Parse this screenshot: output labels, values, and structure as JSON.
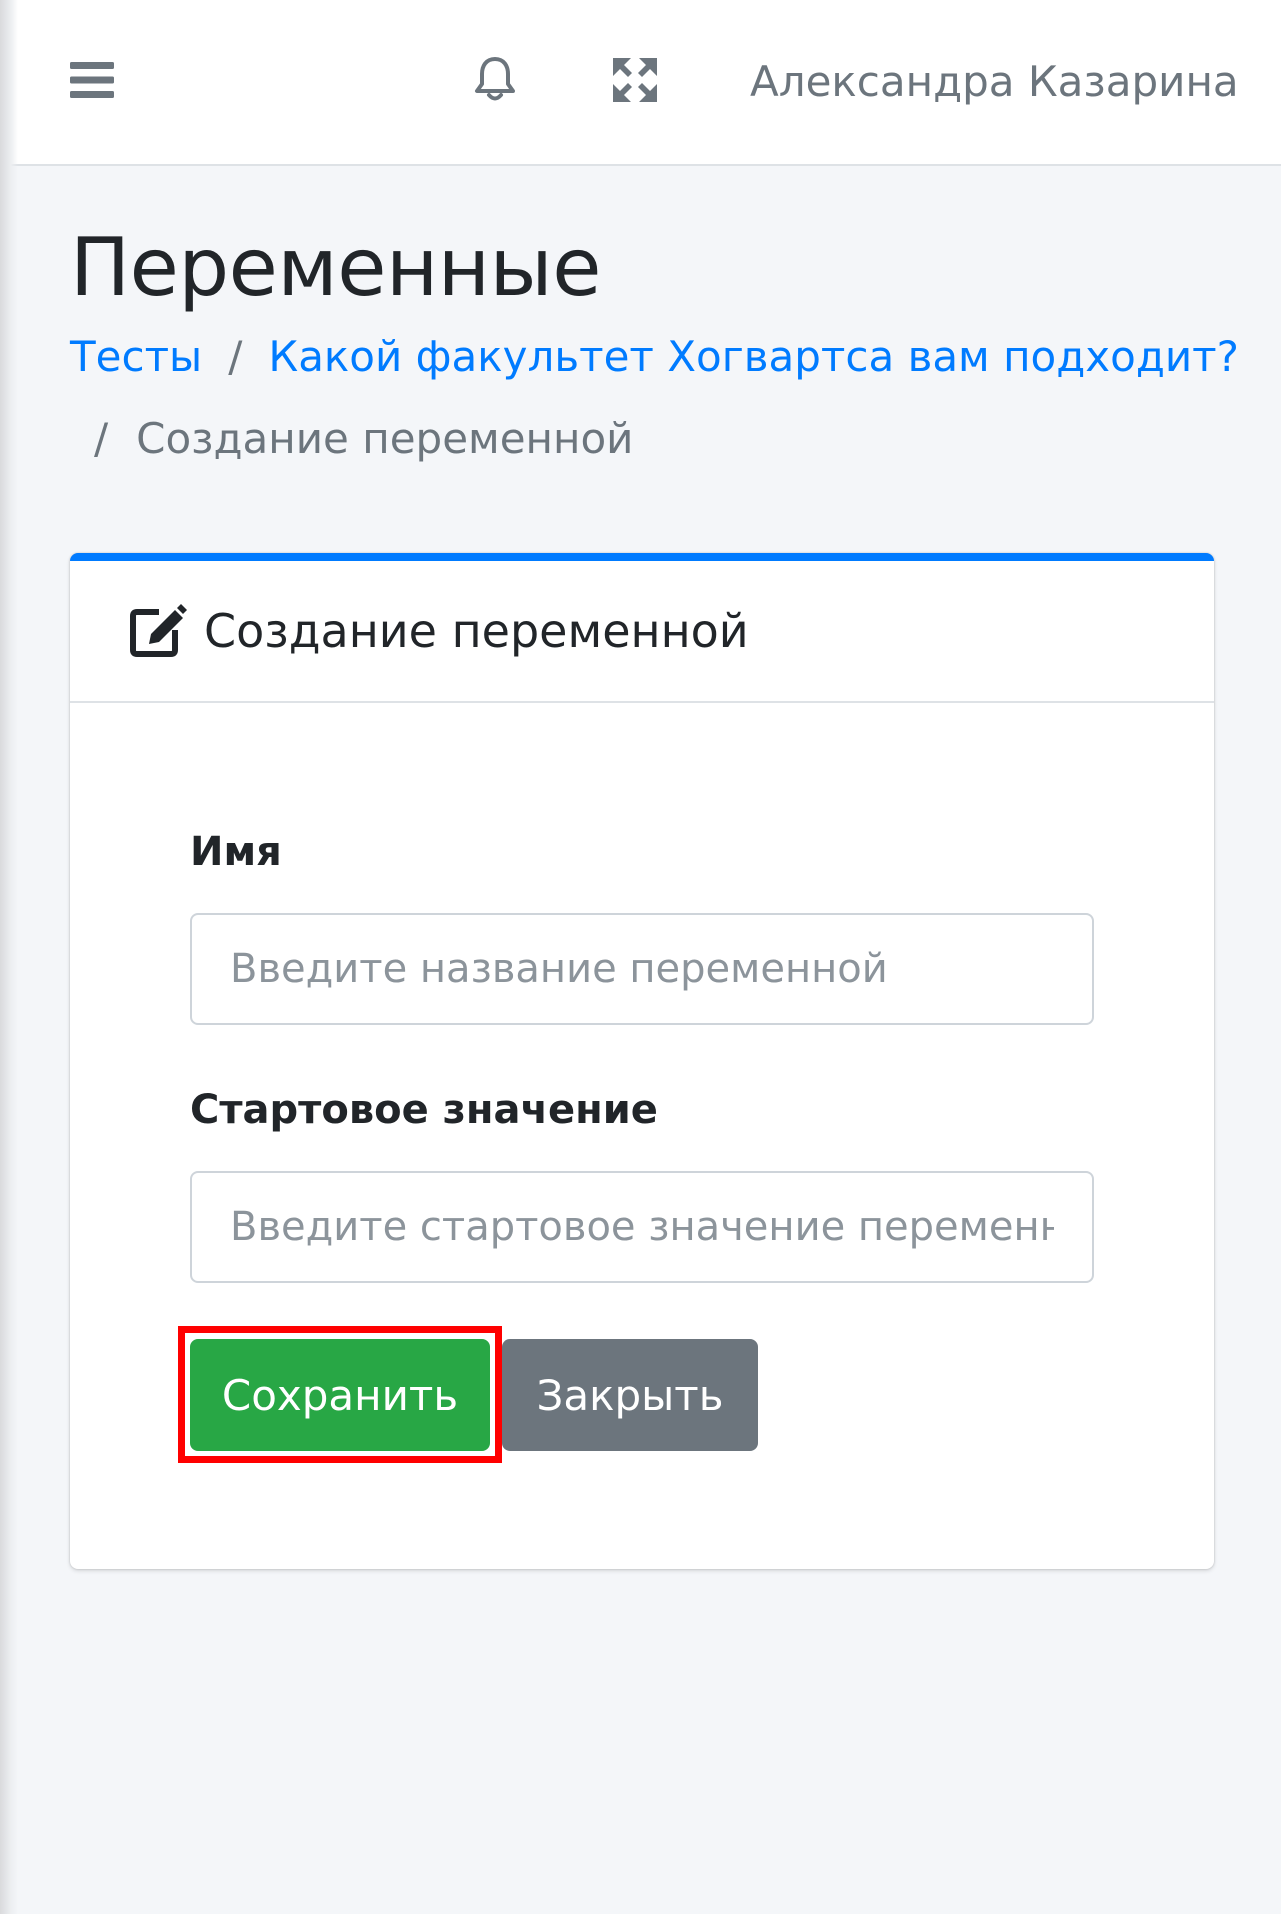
{
  "navbar": {
    "menu_icon": "hamburger-icon",
    "notifications_icon": "bell-icon",
    "fullscreen_icon": "expand-arrows-icon",
    "user_name": "Александра Казарина"
  },
  "page": {
    "title": "Переменные"
  },
  "breadcrumb": {
    "items": [
      {
        "label": "Тесты",
        "link": true
      },
      {
        "label": "Какой факультет Хогвартса вам подходит?",
        "link": true
      },
      {
        "label": "Создание переменной",
        "link": false
      }
    ],
    "separator": "/"
  },
  "card": {
    "header_icon": "edit-square-icon",
    "title": "Создание переменной",
    "accent_color": "#007bff",
    "fields": {
      "name": {
        "label": "Имя",
        "value": "",
        "placeholder": "Введите название переменной"
      },
      "start_value": {
        "label": "Стартовое значение",
        "value": "",
        "placeholder": "Введите стартовое значение переменной"
      }
    },
    "buttons": {
      "save": {
        "label": "Сохранить",
        "color": "#28a745",
        "highlighted": true
      },
      "close": {
        "label": "Закрыть",
        "color": "#6c757d"
      }
    }
  },
  "highlight_color": "#ff0000"
}
